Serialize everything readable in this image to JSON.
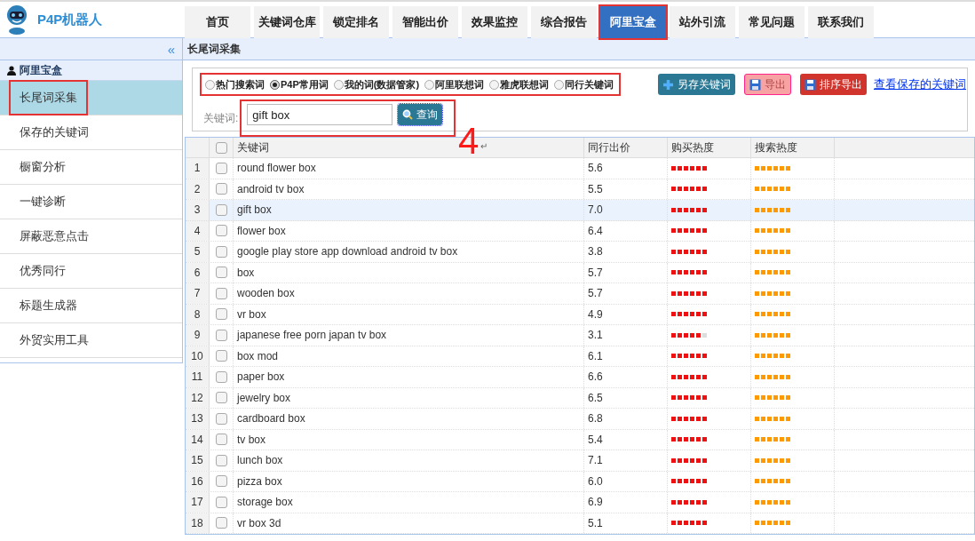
{
  "logo": {
    "text": "P4P机器人"
  },
  "nav_tabs": [
    {
      "label": "首页",
      "selected": false
    },
    {
      "label": "关键词仓库",
      "selected": false
    },
    {
      "label": "锁定排名",
      "selected": false
    },
    {
      "label": "智能出价",
      "selected": false
    },
    {
      "label": "效果监控",
      "selected": false
    },
    {
      "label": "综合报告",
      "selected": false
    },
    {
      "label": "阿里宝盒",
      "selected": true
    },
    {
      "label": "站外引流",
      "selected": false
    },
    {
      "label": "常见问题",
      "selected": false
    },
    {
      "label": "联系我们",
      "selected": false
    }
  ],
  "sidebar": {
    "collapse": "«",
    "group": "阿里宝盒",
    "items": [
      {
        "label": "长尾词采集",
        "selected": true
      },
      {
        "label": "保存的关键词",
        "selected": false
      },
      {
        "label": "橱窗分析",
        "selected": false
      },
      {
        "label": "一键诊断",
        "selected": false
      },
      {
        "label": "屏蔽恶意点击",
        "selected": false
      },
      {
        "label": "优秀同行",
        "selected": false
      },
      {
        "label": "标题生成器",
        "selected": false
      },
      {
        "label": "外贸实用工具",
        "selected": false
      }
    ]
  },
  "panel_title": "长尾词采集",
  "sources": [
    {
      "label": "热门搜索词",
      "selected": false
    },
    {
      "label": "P4P常用词",
      "selected": true
    },
    {
      "label": "我的词(数据管家)",
      "selected": false
    },
    {
      "label": "阿里联想词",
      "selected": false
    },
    {
      "label": "雅虎联想词",
      "selected": false
    },
    {
      "label": "同行关键词",
      "selected": false
    }
  ],
  "actions": [
    {
      "label": "另存关键词",
      "kind": "add"
    },
    {
      "label": "导出",
      "kind": "export-light"
    },
    {
      "label": "排序导出",
      "kind": "export"
    }
  ],
  "saved_link": "查看保存的关键词",
  "search": {
    "label": "关键词:",
    "value": "gift box",
    "button": "查询"
  },
  "annotation": {
    "step": "4",
    "mark": "↵"
  },
  "table": {
    "columns": [
      "关键词",
      "同行出价",
      "购买热度",
      "搜索热度"
    ],
    "header_checked": false,
    "rows": [
      {
        "index": "1",
        "keyword": "round flower box",
        "price": "5.6",
        "buy_heat": {
          "level": 1
        },
        "search_heat": {
          "level": 1
        },
        "checked": false,
        "selected": false
      },
      {
        "index": "2",
        "keyword": "android tv box",
        "price": "5.5",
        "buy_heat": {
          "level": 1
        },
        "search_heat": {
          "level": 1
        },
        "checked": false,
        "selected": false
      },
      {
        "index": "3",
        "keyword": "gift box",
        "price": "7.0",
        "buy_heat": {
          "level": 1
        },
        "search_heat": {
          "level": 1
        },
        "checked": false,
        "selected": true
      },
      {
        "index": "4",
        "keyword": "flower box",
        "price": "6.4",
        "buy_heat": {
          "level": 1
        },
        "search_heat": {
          "level": 1
        },
        "checked": false,
        "selected": false
      },
      {
        "index": "5",
        "keyword": "google play store app download android tv box",
        "price": "3.8",
        "buy_heat": {
          "level": 1
        },
        "search_heat": {
          "level": 1
        },
        "checked": false,
        "selected": false
      },
      {
        "index": "6",
        "keyword": "box",
        "price": "5.7",
        "buy_heat": {
          "level": 1
        },
        "search_heat": {
          "level": 1
        },
        "checked": false,
        "selected": false
      },
      {
        "index": "7",
        "keyword": "wooden box",
        "price": "5.7",
        "buy_heat": {
          "level": 1
        },
        "search_heat": {
          "level": 1
        },
        "checked": false,
        "selected": false
      },
      {
        "index": "8",
        "keyword": "vr box",
        "price": "4.9",
        "buy_heat": {
          "level": 1
        },
        "search_heat": {
          "level": 1
        },
        "checked": false,
        "selected": false
      },
      {
        "index": "9",
        "keyword": "japanese free porn japan tv box",
        "price": "3.1",
        "buy_heat": {
          "level": 0.83
        },
        "search_heat": {
          "level": 1
        },
        "checked": false,
        "selected": false
      },
      {
        "index": "10",
        "keyword": "box mod",
        "price": "6.1",
        "buy_heat": {
          "level": 1
        },
        "search_heat": {
          "level": 1
        },
        "checked": false,
        "selected": false
      },
      {
        "index": "11",
        "keyword": "paper box",
        "price": "6.6",
        "buy_heat": {
          "level": 1
        },
        "search_heat": {
          "level": 1
        },
        "checked": false,
        "selected": false
      },
      {
        "index": "12",
        "keyword": "jewelry box",
        "price": "6.5",
        "buy_heat": {
          "level": 1
        },
        "search_heat": {
          "level": 1
        },
        "checked": false,
        "selected": false
      },
      {
        "index": "13",
        "keyword": "cardboard box",
        "price": "6.8",
        "buy_heat": {
          "level": 1
        },
        "search_heat": {
          "level": 1
        },
        "checked": false,
        "selected": false
      },
      {
        "index": "14",
        "keyword": "tv box",
        "price": "5.4",
        "buy_heat": {
          "level": 1
        },
        "search_heat": {
          "level": 1
        },
        "checked": false,
        "selected": false
      },
      {
        "index": "15",
        "keyword": "lunch box",
        "price": "7.1",
        "buy_heat": {
          "level": 1
        },
        "search_heat": {
          "level": 1
        },
        "checked": false,
        "selected": false
      },
      {
        "index": "16",
        "keyword": "pizza box",
        "price": "6.0",
        "buy_heat": {
          "level": 1
        },
        "search_heat": {
          "level": 1
        },
        "checked": false,
        "selected": false
      },
      {
        "index": "17",
        "keyword": "storage box",
        "price": "6.9",
        "buy_heat": {
          "level": 1
        },
        "search_heat": {
          "level": 1
        },
        "checked": false,
        "selected": false
      },
      {
        "index": "18",
        "keyword": "vr box 3d",
        "price": "5.1",
        "buy_heat": {
          "level": 1
        },
        "search_heat": {
          "level": 1
        },
        "checked": false,
        "selected": false
      }
    ]
  }
}
